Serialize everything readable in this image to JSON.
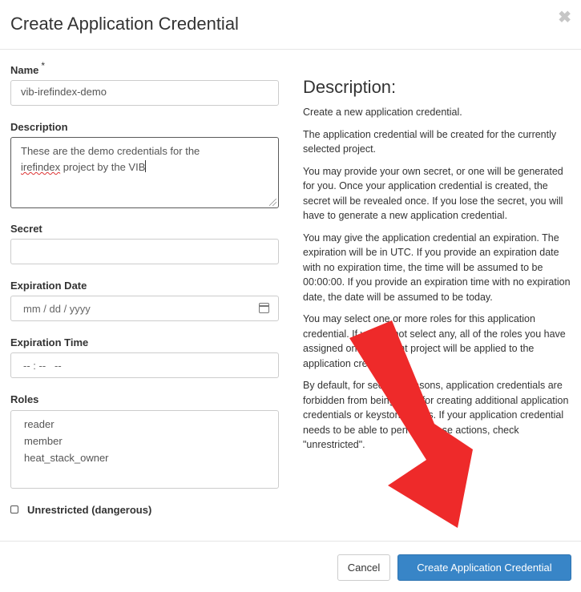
{
  "dialog": {
    "title": "Create Application Credential",
    "close_symbol": "✖"
  },
  "form": {
    "name": {
      "label": "Name",
      "required_mark": "*",
      "value": "vib-irefindex-demo"
    },
    "description": {
      "label": "Description",
      "value_line1": "These are the demo credentials for the",
      "value_line2_misspelled": "irefindex",
      "value_line2_rest": " project by the VIB"
    },
    "secret": {
      "label": "Secret",
      "value": ""
    },
    "expiration_date": {
      "label": "Expiration Date",
      "placeholder": "mm / dd / yyyy"
    },
    "expiration_time": {
      "label": "Expiration Time",
      "placeholder": "-- : --   --"
    },
    "roles": {
      "label": "Roles",
      "options": [
        "reader",
        "member",
        "heat_stack_owner"
      ]
    },
    "unrestricted": {
      "label": "Unrestricted (dangerous)",
      "checked": false
    }
  },
  "description_panel": {
    "title": "Description:",
    "paragraphs": [
      "Create a new application credential.",
      "The application credential will be created for the currently selected project.",
      "You may provide your own secret, or one will be generated for you. Once your application credential is created, the secret will be revealed once. If you lose the secret, you will have to generate a new application credential.",
      "You may give the application credential an expiration. The expiration will be in UTC. If you provide an expiration date with no expiration time, the time will be assumed to be 00:00:00. If you provide an expiration time with no expiration date, the date will be assumed to be today.",
      "You may select one or more roles for this application credential. If you do not select any, all of the roles you have assigned on the current project will be applied to the application credential.",
      "By default, for security reasons, application credentials are forbidden from being used for creating additional application credentials or keystone trusts. If your application credential needs to be able to perform these actions, check \"unrestricted\"."
    ]
  },
  "footer": {
    "cancel_label": "Cancel",
    "create_label": "Create Application Credential"
  },
  "annotation": {
    "arrow_color": "#ee2a2a"
  },
  "colors": {
    "primary": "#3885c7",
    "border": "#cccccc"
  }
}
